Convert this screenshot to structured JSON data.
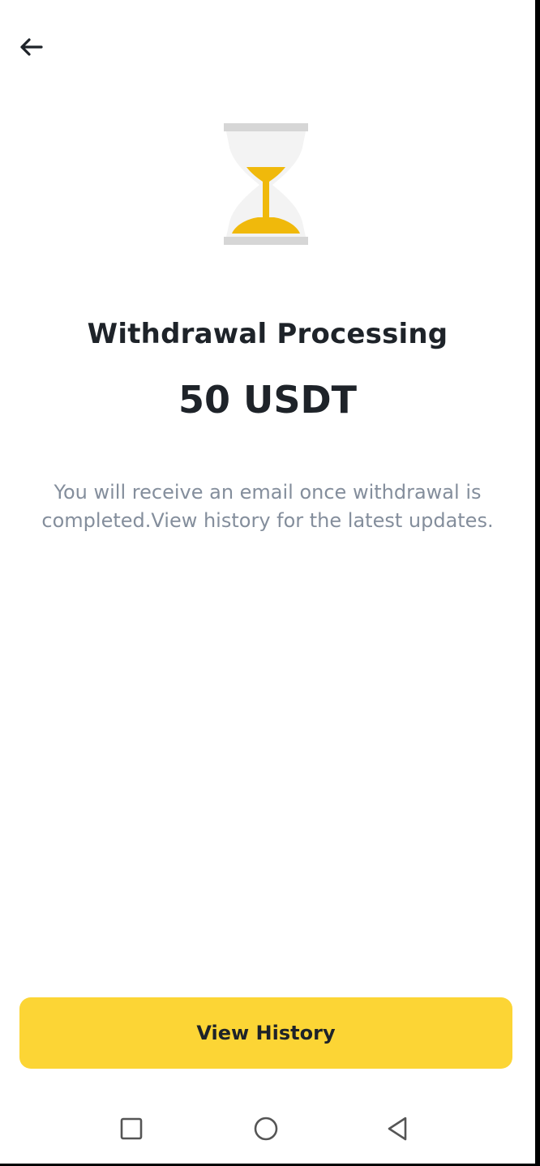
{
  "header": {
    "back_icon": "arrow-left-icon"
  },
  "status": {
    "icon": "hourglass-icon",
    "title": "Withdrawal Processing",
    "amount": "50 USDT",
    "description": "You will receive an email once withdrawal is completed.View history for the latest updates."
  },
  "actions": {
    "view_history_label": "View History"
  },
  "system_nav": {
    "items": [
      "recents-square-icon",
      "home-circle-icon",
      "back-triangle-icon"
    ]
  },
  "colors": {
    "accent": "#fcd535",
    "sand": "#f0b90b",
    "text_primary": "#1e2329",
    "text_secondary": "#848e9c",
    "glass_frame": "#d6d6d6"
  }
}
